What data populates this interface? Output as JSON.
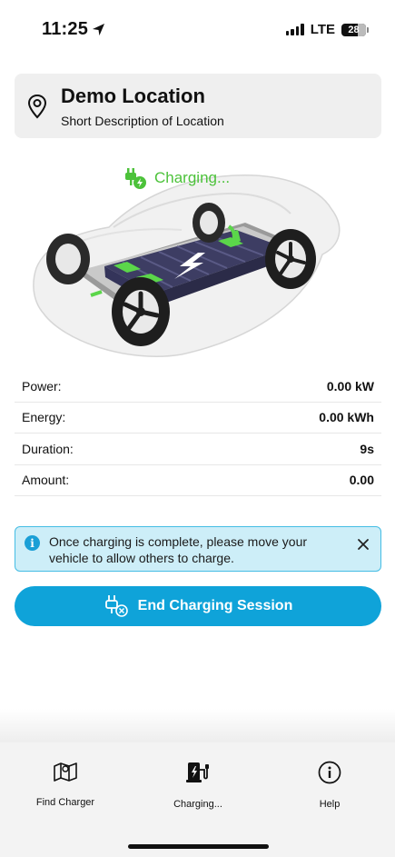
{
  "status_bar": {
    "time": "11:25",
    "network": "LTE",
    "battery": "28",
    "location_icon": "location-arrow-icon"
  },
  "location": {
    "icon": "map-pin-icon",
    "title": "Demo Location",
    "description": "Short Description of Location"
  },
  "charging_status": {
    "icon": "plug-charging-icon",
    "text": "Charging...",
    "color": "#4cc23a"
  },
  "stats": [
    {
      "label": "Power:",
      "value": "0.00 kW"
    },
    {
      "label": "Energy:",
      "value": "0.00 kWh"
    },
    {
      "label": "Duration:",
      "value": "9s"
    },
    {
      "label": "Amount:",
      "value": "0.00"
    }
  ],
  "alert": {
    "icon": "info-icon",
    "text": "Once charging is complete, please move your vehicle to allow others to charge.",
    "close_icon": "close-icon"
  },
  "end_button": {
    "icon": "unplug-icon",
    "label": "End Charging Session",
    "color": "#0fa3d9"
  },
  "nav": {
    "items": [
      {
        "icon": "map-icon",
        "label": "Find Charger"
      },
      {
        "icon": "ev-station-icon",
        "label": "Charging..."
      },
      {
        "icon": "info-circle-icon",
        "label": "Help"
      }
    ]
  }
}
